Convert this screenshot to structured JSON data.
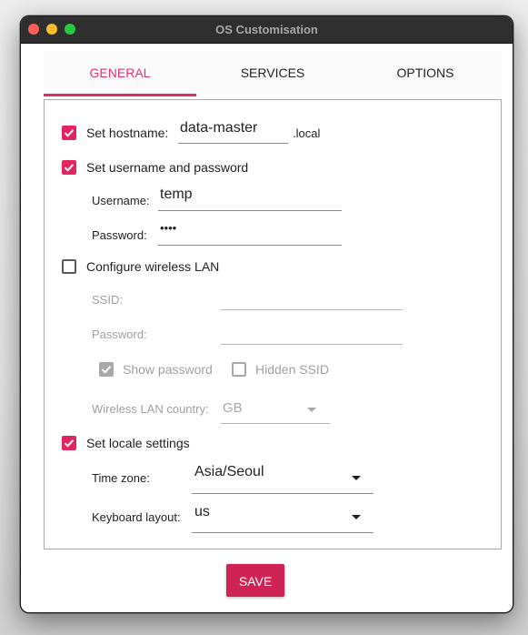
{
  "window": {
    "title": "OS Customisation"
  },
  "tabs": [
    {
      "label": "GENERAL",
      "active": true
    },
    {
      "label": "SERVICES",
      "active": false
    },
    {
      "label": "OPTIONS",
      "active": false
    }
  ],
  "general": {
    "hostname": {
      "checked": true,
      "label": "Set hostname:",
      "value": "data-master",
      "suffix": ".local"
    },
    "user": {
      "checked": true,
      "label": "Set username and password",
      "username_label": "Username:",
      "username_value": "temp",
      "password_label": "Password:",
      "password_value": "••••"
    },
    "wlan": {
      "checked": false,
      "label": "Configure wireless LAN",
      "ssid_label": "SSID:",
      "ssid_value": "",
      "password_label": "Password:",
      "password_value": "",
      "show_password_label": "Show password",
      "show_password_checked": true,
      "hidden_ssid_label": "Hidden SSID",
      "hidden_ssid_checked": false,
      "country_label": "Wireless LAN country:",
      "country_value": "GB"
    },
    "locale": {
      "checked": true,
      "label": "Set locale settings",
      "timezone_label": "Time zone:",
      "timezone_value": "Asia/Seoul",
      "keyboard_label": "Keyboard layout:",
      "keyboard_value": "us"
    }
  },
  "actions": {
    "save_label": "SAVE"
  },
  "colors": {
    "accent": "#e3245e",
    "save_button": "#cf2355",
    "tab_active": "#e8336b"
  }
}
